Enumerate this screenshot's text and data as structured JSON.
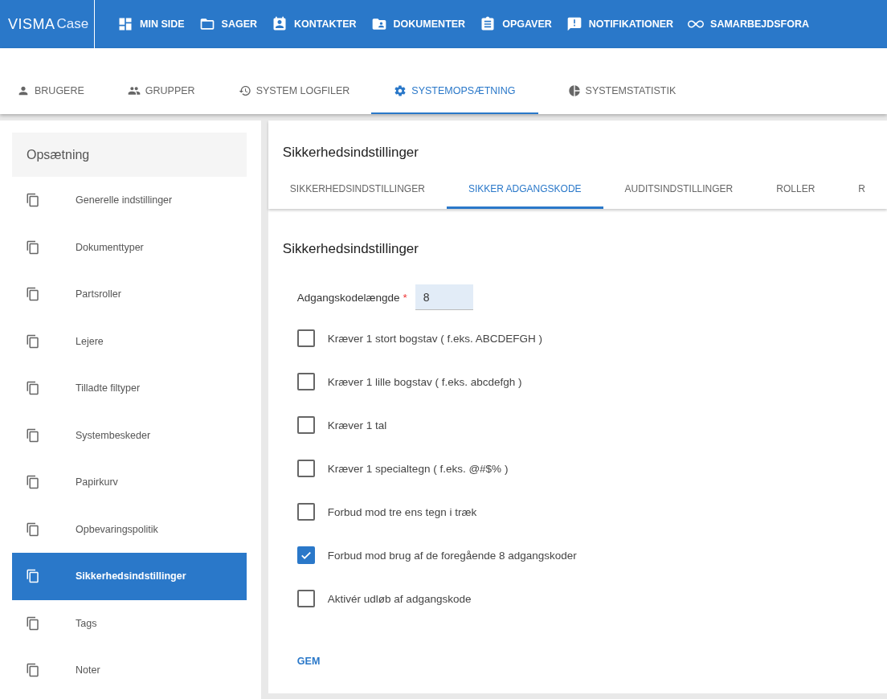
{
  "app_bar": {
    "logo": "VISMA",
    "logo_suffix": "Case",
    "nav": [
      {
        "label": "MIN SIDE"
      },
      {
        "label": "SAGER"
      },
      {
        "label": "KONTAKTER"
      },
      {
        "label": "DOKUMENTER"
      },
      {
        "label": "OPGAVER"
      },
      {
        "label": "NOTIFIKATIONER"
      },
      {
        "label": "SAMARBEJDSFORA"
      }
    ]
  },
  "tabs": [
    {
      "label": "BRUGERE",
      "selected": false
    },
    {
      "label": "GRUPPER",
      "selected": false
    },
    {
      "label": "SYSTEM LOGFILER",
      "selected": false
    },
    {
      "label": "SYSTEMOPSÆTNING",
      "selected": true
    },
    {
      "label": "SYSTEMSTATISTIK",
      "selected": false
    }
  ],
  "sidebar": {
    "title": "Opsætning",
    "items": [
      {
        "label": "Generelle indstillinger",
        "selected": false
      },
      {
        "label": "Dokumenttyper",
        "selected": false
      },
      {
        "label": "Partsroller",
        "selected": false
      },
      {
        "label": "Lejere",
        "selected": false
      },
      {
        "label": "Tilladte filtyper",
        "selected": false
      },
      {
        "label": "Systembeskeder",
        "selected": false
      },
      {
        "label": "Papirkurv",
        "selected": false
      },
      {
        "label": "Opbevaringspolitik",
        "selected": false
      },
      {
        "label": "Sikkerhedsindstillinger",
        "selected": true
      },
      {
        "label": "Tags",
        "selected": false
      },
      {
        "label": "Noter",
        "selected": false
      }
    ]
  },
  "panel": {
    "title": "Sikkerhedsindstillinger",
    "tabs": [
      {
        "label": "SIKKERHEDSINDSTILLINGER",
        "selected": false
      },
      {
        "label": "SIKKER ADGANGSKODE",
        "selected": true
      },
      {
        "label": "AUDITSINDSTILLINGER",
        "selected": false
      },
      {
        "label": "ROLLER",
        "selected": false
      },
      {
        "label": "R",
        "selected": false
      }
    ],
    "section_title": "Sikkerhedsindstillinger",
    "length_field": {
      "label": "Adgangskodelængde",
      "required_mark": "*",
      "value": "8"
    },
    "options": [
      {
        "label": "Kræver 1 stort bogstav ( f.eks. ABCDEFGH )",
        "checked": false
      },
      {
        "label": "Kræver 1 lille bogstav ( f.eks. abcdefgh )",
        "checked": false
      },
      {
        "label": "Kræver 1 tal",
        "checked": false
      },
      {
        "label": "Kræver 1 specialtegn ( f.eks. @#$% )",
        "checked": false
      },
      {
        "label": "Forbud mod tre ens tegn i træk",
        "checked": false
      },
      {
        "label": "Forbud mod brug af de foregående 8 adgangskoder",
        "checked": true
      },
      {
        "label": "Aktivér udløb af adgangskode",
        "checked": false
      }
    ],
    "save_button": "GEM"
  }
}
